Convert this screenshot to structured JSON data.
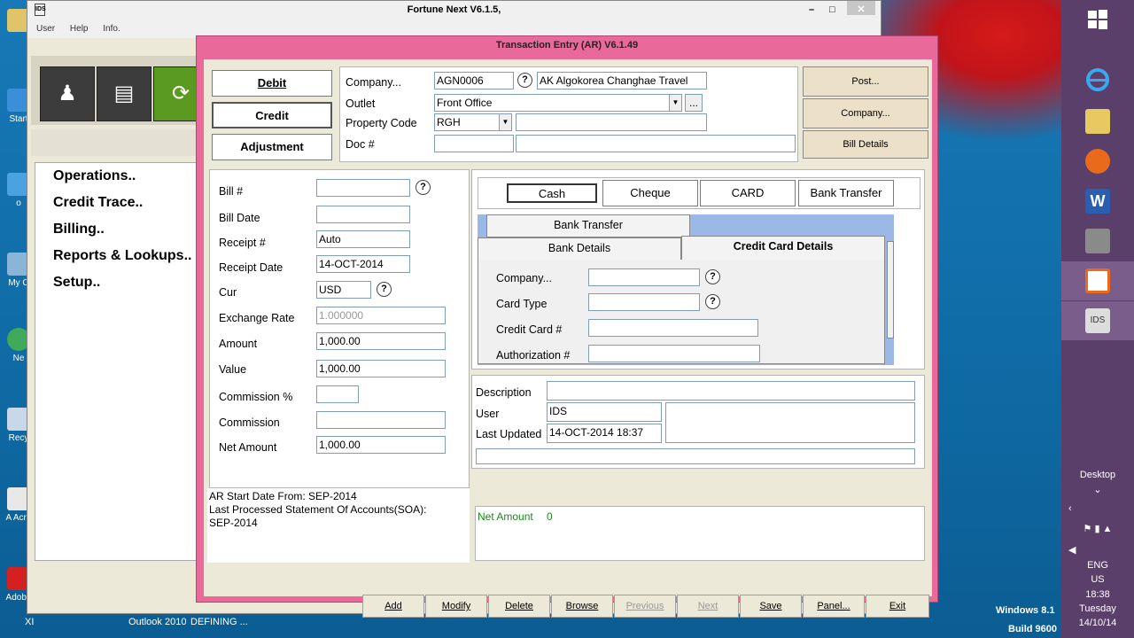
{
  "main_window": {
    "title": "Fortune Next  V6.1.5,",
    "menu": [
      "User",
      "Help",
      "Info."
    ],
    "nav_items": [
      "Operations..",
      "Credit Trace..",
      "Billing..",
      "Reports & Lookups..",
      "Setup.."
    ]
  },
  "dialog": {
    "title": "Transaction Entry (AR) V6.1.49",
    "type_buttons": [
      "Debit",
      "Credit",
      "Adjustment"
    ],
    "header": {
      "company_label": "Company...",
      "company_code": "AGN0006",
      "company_name": "AK Algokorea Changhae Travel",
      "outlet_label": "Outlet",
      "outlet_value": "Front Office",
      "outlet_more": "...",
      "property_label": "Property Code",
      "property_value": "RGH",
      "doc_label": "Doc #"
    },
    "side_buttons": [
      "Post...",
      "Company...",
      "Bill Details"
    ],
    "left_form": {
      "bill_label": "Bill #",
      "bill_date_label": "Bill Date",
      "receipt_label": "Receipt #",
      "receipt_value": "Auto",
      "receipt_date_label": "Receipt Date",
      "receipt_date_value": "14-OCT-2014",
      "cur_label": "Cur",
      "cur_value": "USD",
      "exchange_label": "Exchange Rate",
      "exchange_value": "1.000000",
      "amount_label": "Amount",
      "amount_value": "1,000.00",
      "value_label": "Value",
      "value_value": "1,000.00",
      "commission_pct_label": "Commission %",
      "commission_label": "Commission",
      "net_amount_label": "Net Amount",
      "net_amount_value": "1,000.00"
    },
    "ar_info": {
      "line1": "AR Start Date From: SEP-2014",
      "line2": "Last Processed Statement Of Accounts(SOA):",
      "line3": "SEP-2014"
    },
    "payment_buttons": [
      "Cash",
      "Cheque",
      "CARD",
      "Bank Transfer"
    ],
    "tabs": {
      "bank_transfer": "Bank Transfer",
      "bank_details": "Bank Details",
      "credit_card_details": "Credit Card Details"
    },
    "card_form": {
      "company_label": "Company...",
      "card_type_label": "Card Type",
      "credit_card_label": "Credit Card #",
      "authorization_label": "Authorization #"
    },
    "meta": {
      "description_label": "Description",
      "user_label": "User",
      "user_value": "IDS",
      "last_updated_label": "Last Updated",
      "last_updated_value": "14-OCT-2014 18:37"
    },
    "net_amount": {
      "label": "Net Amount",
      "value": "0"
    },
    "bottom_buttons": [
      {
        "label": "Add",
        "enabled": true
      },
      {
        "label": "Modify",
        "enabled": true
      },
      {
        "label": "Delete",
        "enabled": true
      },
      {
        "label": "Browse",
        "enabled": true
      },
      {
        "label": "Previous",
        "enabled": false
      },
      {
        "label": "Next",
        "enabled": false
      },
      {
        "label": "Save",
        "enabled": true
      },
      {
        "label": "Panel...",
        "enabled": true
      },
      {
        "label": "Exit",
        "enabled": true
      }
    ]
  },
  "desktop": {
    "icon_labels": [
      "Start",
      "o",
      "My C",
      "Ne",
      "Recy",
      "A\nAcro",
      "Adobe"
    ],
    "taskbar": [
      "XI",
      "Outlook 2010",
      "DEFINING ..."
    ],
    "os_name": "Windows 8.1",
    "os_build": "Build 9600"
  },
  "charms": {
    "desktop_label": "Desktop",
    "lang": "ENG",
    "region": "US",
    "time": "18:38",
    "day": "Tuesday",
    "date": "14/10/14"
  },
  "colors": {
    "dialog_border": "#e96a9a",
    "charms_bg": "#5b3f6b",
    "net_amount_text": "#1a8a1a"
  }
}
